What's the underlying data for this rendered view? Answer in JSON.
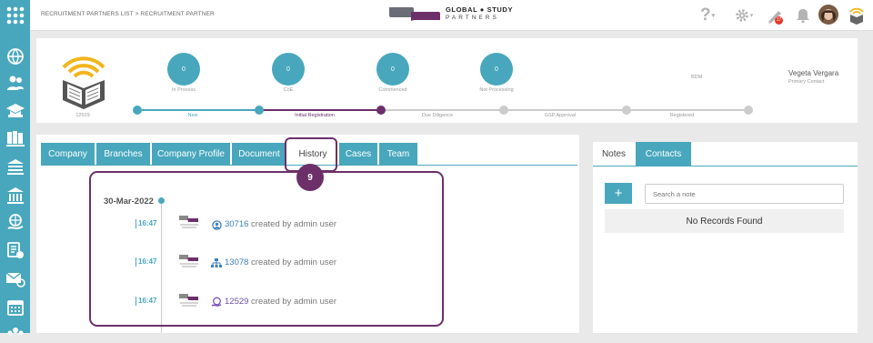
{
  "breadcrumb": "RECRUITMENT PARTNERS LIST > RECRUITMENT PARTNER",
  "logo": {
    "line1": "GLOBAL ● STUDY",
    "line2": "PARTNERS"
  },
  "header_icons": {
    "help": "?",
    "notification_count": "17"
  },
  "sidebar": {
    "items": [
      "menu-grid-icon",
      "globe-icon",
      "users-icon",
      "graduation-icon",
      "books-icon",
      "school-icon",
      "institution-icon",
      "globe-hand-icon",
      "checklist-clock-icon",
      "mail-at-icon",
      "calendar-icon",
      "org-icon"
    ]
  },
  "partner": {
    "id": "12529",
    "stats": [
      {
        "value": "0",
        "label": "In Process"
      },
      {
        "value": "0",
        "label": "CoE"
      },
      {
        "value": "0",
        "label": "Commenced"
      },
      {
        "value": "0",
        "label": "Not Processing"
      }
    ],
    "bdm_label": "BDM",
    "contact_name": "Vegeta Vergara",
    "contact_role": "Primary Contact",
    "stages": [
      "New",
      "Initial Registration",
      "Due Diligence",
      "GSP Approval",
      "Registered"
    ]
  },
  "tabs": [
    "Company",
    "Branches",
    "Company Profile",
    "Document",
    "History",
    "Cases",
    "Team"
  ],
  "active_tab": "History",
  "annotation_number": "9",
  "history": {
    "date": "30-Mar-2022",
    "entries": [
      {
        "time": "16:47",
        "id": "30716",
        "text": " created by admin user"
      },
      {
        "time": "16:47",
        "id": "13078",
        "text": " created by admin user"
      },
      {
        "time": "16:47",
        "id": "12529",
        "text": " created by admin user"
      }
    ]
  },
  "notes": {
    "tabs": [
      "Notes",
      "Contacts"
    ],
    "add_label": "+",
    "search_placeholder": "Search a note",
    "empty_text": "No Records Found"
  },
  "colors": {
    "accent": "#48a7bd",
    "purple": "#6d2f6a",
    "gold": "#f2b51b"
  }
}
